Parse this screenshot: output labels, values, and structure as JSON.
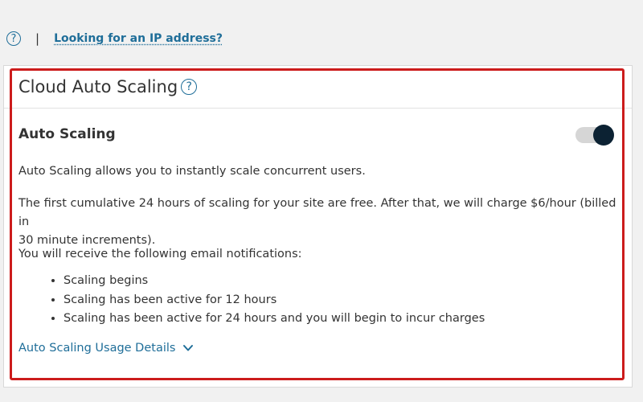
{
  "topbar": {
    "help_icon_glyph": "?",
    "separator": "|",
    "ip_link": "Looking for an IP address?"
  },
  "card": {
    "title": "Cloud Auto Scaling",
    "title_help_glyph": "?",
    "section_title": "Auto Scaling",
    "toggle_state": "on",
    "paragraph_1": "Auto Scaling allows you to instantly scale concurrent users.",
    "paragraph_2_line_1": "The first cumulative 24 hours of scaling for your site are free. After that, we will charge $6/hour (billed in",
    "paragraph_2_line_2": "30 minute increments).",
    "paragraph_3": "You will receive the following email notifications:",
    "notifications": [
      "Scaling begins",
      "Scaling has been active for 12 hours",
      "Scaling has been active for 24 hours and you will begin to incur charges"
    ],
    "details_link": "Auto Scaling Usage Details",
    "details_icon": "chevron-down-icon"
  },
  "colors": {
    "accent": "#1f6e99",
    "toggle_knob": "#0c2233",
    "toggle_track": "#d6d6d6",
    "highlight": "#cc1c1c",
    "background": "#f1f1f1"
  }
}
